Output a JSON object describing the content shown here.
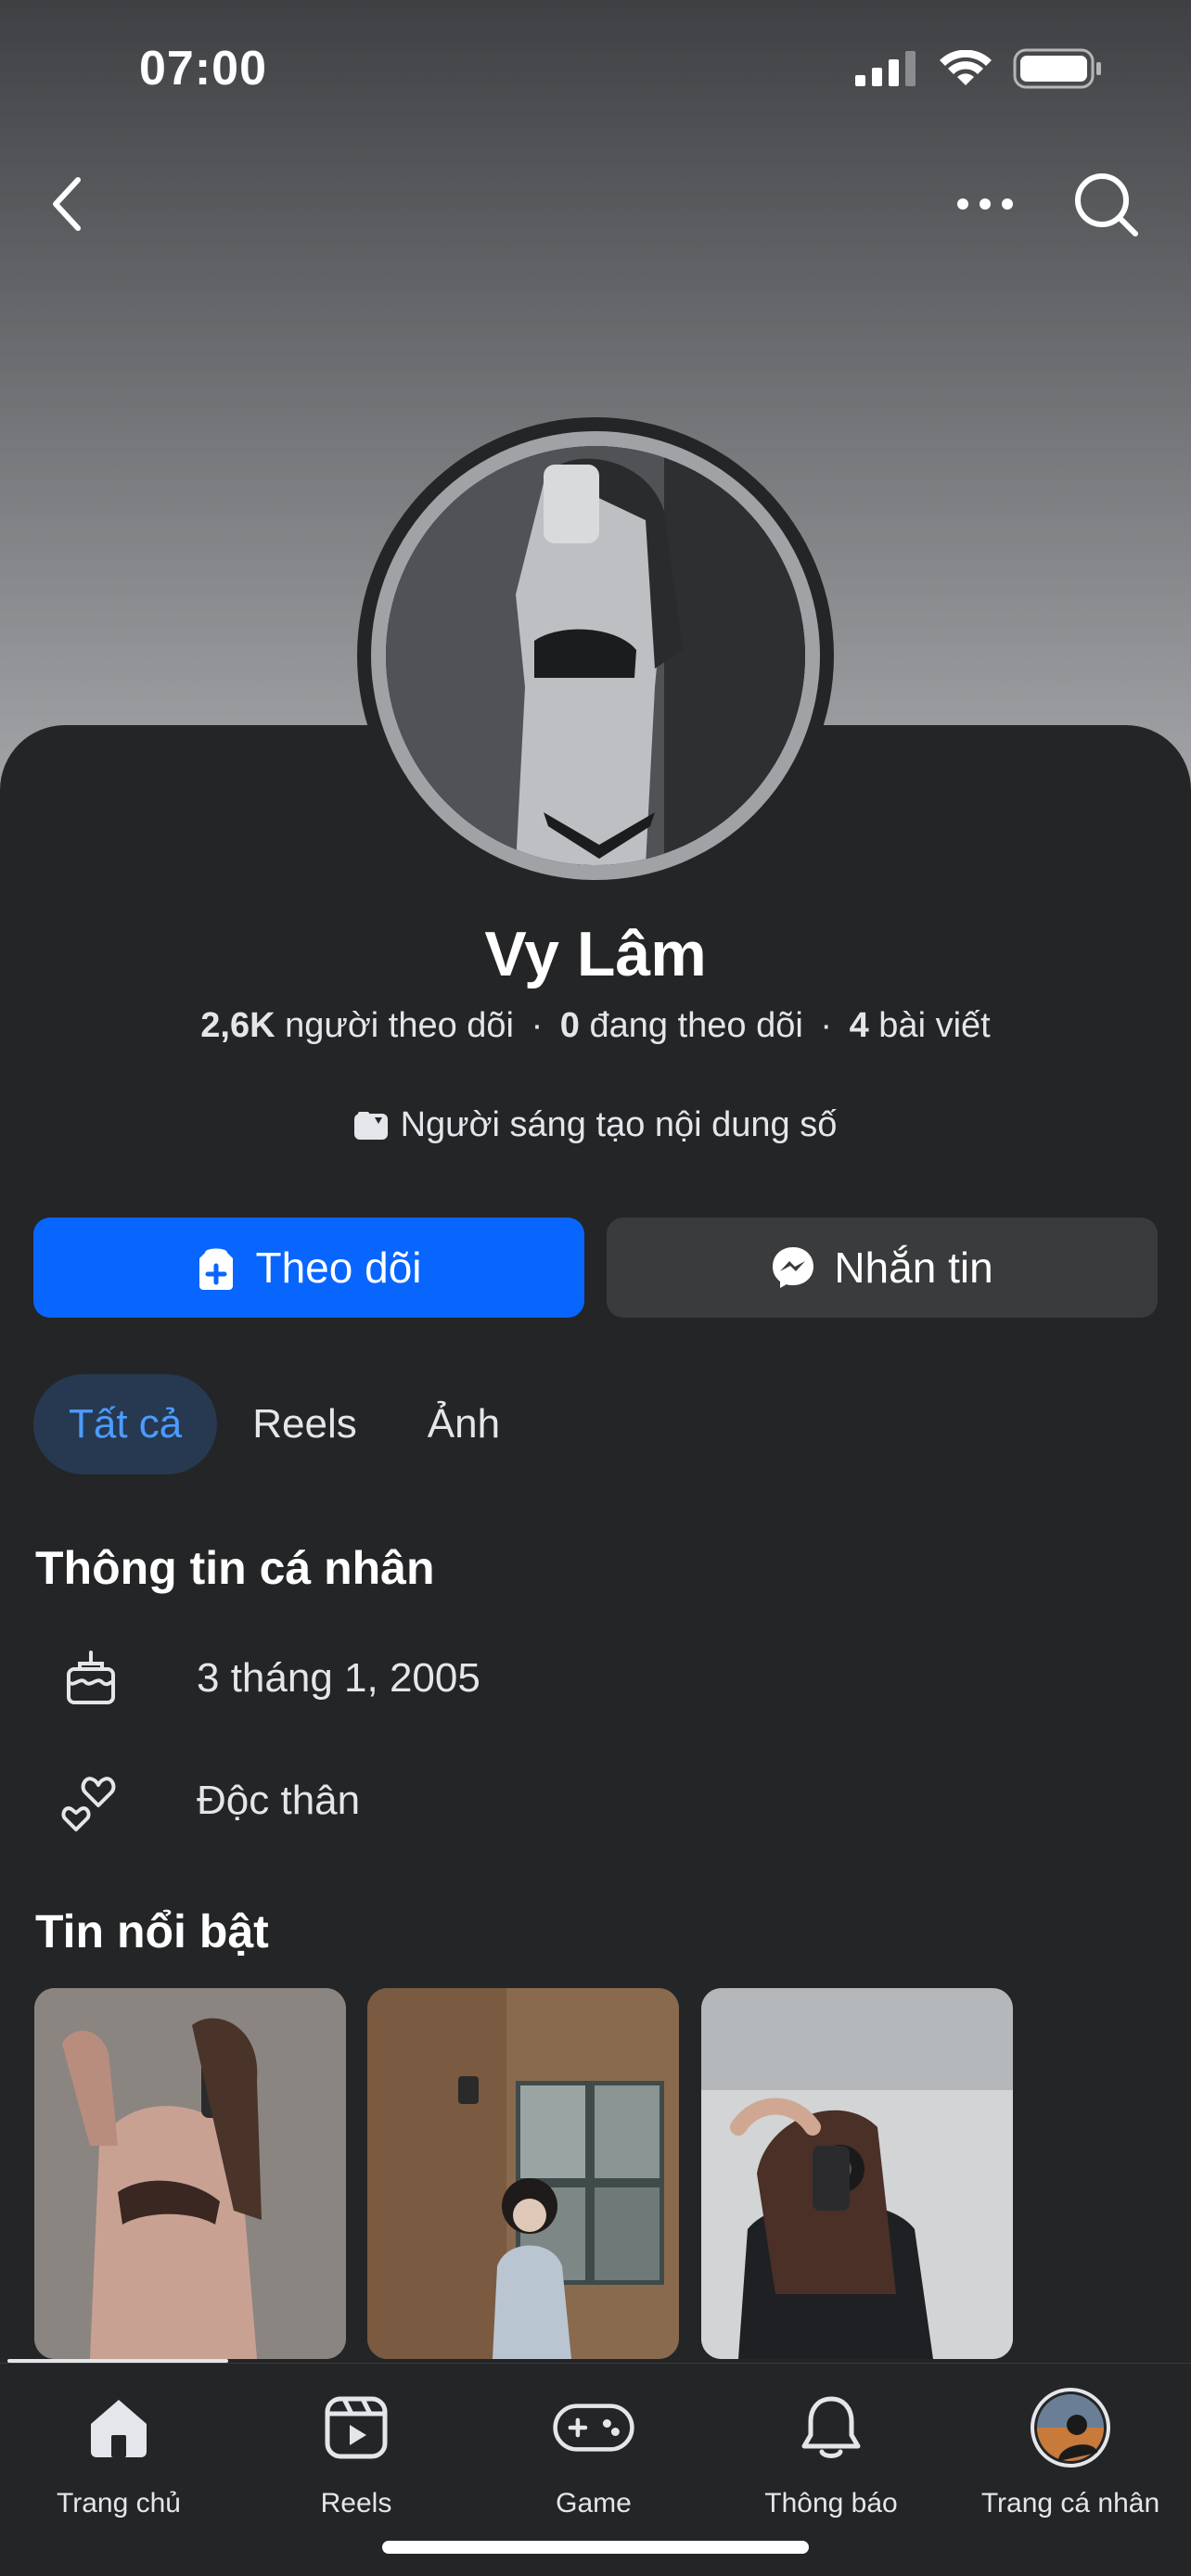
{
  "status_bar": {
    "time": "07:00"
  },
  "profile": {
    "name": "Vy Lâm",
    "followers": "2,6K",
    "followers_label": "người theo dõi",
    "following": "0",
    "following_label": "đang theo dõi",
    "posts": "4",
    "posts_label": "bài viết",
    "separator": "·",
    "category": "Người sáng tạo nội dung số"
  },
  "actions": {
    "follow_label": "Theo dõi",
    "message_label": "Nhắn tin"
  },
  "tabs": [
    {
      "label": "Tất cả",
      "active": true
    },
    {
      "label": "Reels",
      "active": false
    },
    {
      "label": "Ảnh",
      "active": false
    }
  ],
  "about": {
    "title": "Thông tin cá nhân",
    "birthday": "3 tháng 1, 2005",
    "relationship": "Độc thân"
  },
  "highlights": {
    "title": "Tin nổi bật"
  },
  "bottom_nav": [
    {
      "label": "Trang chủ",
      "icon": "home-icon",
      "active": true
    },
    {
      "label": "Reels",
      "icon": "reels-icon"
    },
    {
      "label": "Game",
      "icon": "gamepad-icon"
    },
    {
      "label": "Thông báo",
      "icon": "bell-icon"
    },
    {
      "label": "Trang cá nhân",
      "icon": "profile-avatar"
    }
  ],
  "colors": {
    "primary": "#0866FF",
    "background": "#242526",
    "surface": "#3A3B3C",
    "active_tab_bg": "#263951",
    "active_tab_text": "#4C9BFF"
  }
}
